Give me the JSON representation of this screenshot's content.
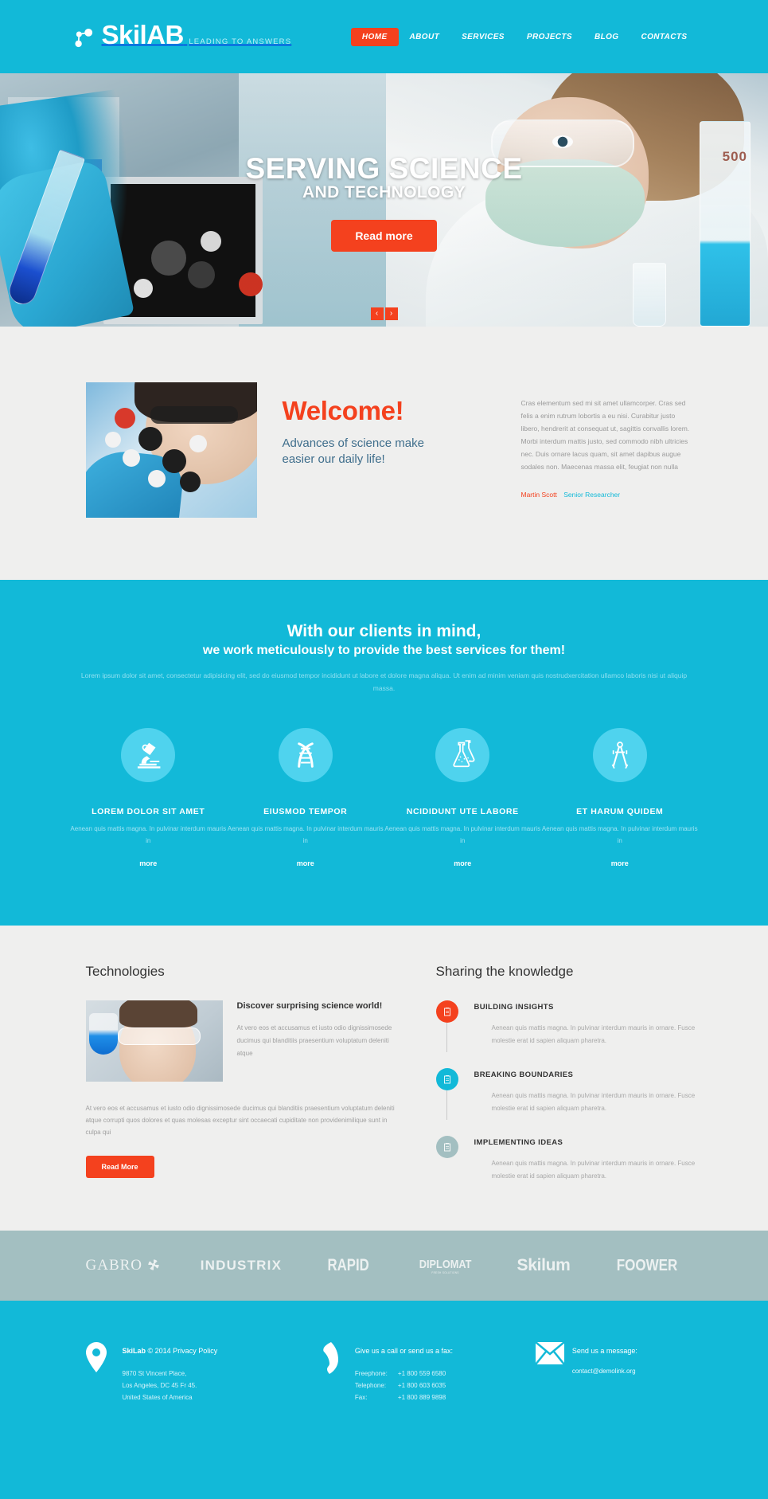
{
  "header": {
    "logo_name": "SkilAB",
    "logo_tagline": "LEADING TO ANSWERS",
    "nav": [
      {
        "label": "HOME",
        "active": true
      },
      {
        "label": "ABOUT",
        "active": false
      },
      {
        "label": "SERVICES",
        "active": false
      },
      {
        "label": "PROJECTS",
        "active": false
      },
      {
        "label": "BLOG",
        "active": false
      },
      {
        "label": "CONTACTS",
        "active": false
      }
    ]
  },
  "hero": {
    "title_line1": "SERVING SCIENCE",
    "title_line2": "AND TECHNOLOGY",
    "button": "Read more",
    "prev": "‹",
    "next": "›",
    "cylinder_label": "500"
  },
  "welcome": {
    "heading": "Welcome!",
    "subheading": "Advances of science make easier our daily life!",
    "paragraph": "Cras elementum sed mi sit amet ullamcorper. Cras sed felis a enim rutrum lobortis a eu nisi. Curabitur justo libero, hendrerit at consequat ut, sagittis convallis lorem. Morbi interdum mattis justo, sed commodo nibh ultricies nec. Duis ornare lacus quam, sit amet dapibus augue sodales non. Maecenas massa elit, feugiat non nulla",
    "credit_name": "Martin Scott",
    "credit_role": "Senior Researcher"
  },
  "clients": {
    "heading1": "With our clients in mind,",
    "heading2": "we work meticulously to provide the best services for them!",
    "paragraph": "Lorem ipsum dolor sit amet, consectetur adipisicing elit, sed do eiusmod tempor incididunt ut labore et dolore magna aliqua. Ut enim ad minim veniam quis nostrudxercitation ullamco laboris nisi ut aliquip massa.",
    "services": [
      {
        "icon": "microscope-icon",
        "title": "LOREM DOLOR SIT AMET",
        "text": "Aenean quis mattis magna. In pulvinar interdum mauris in",
        "more": "more"
      },
      {
        "icon": "dna-icon",
        "title": "EIUSMOD TEMPOR",
        "text": "Aenean quis mattis magna. In pulvinar interdum mauris in",
        "more": "more"
      },
      {
        "icon": "flasks-icon",
        "title": "NCIDIDUNT UTE LABORE",
        "text": "Aenean quis mattis magna. In pulvinar interdum mauris in",
        "more": "more"
      },
      {
        "icon": "compass-icon",
        "title": "ET HARUM QUIDEM",
        "text": "Aenean quis mattis magna. In pulvinar interdum mauris in",
        "more": "more"
      }
    ]
  },
  "technologies": {
    "heading": "Technologies",
    "card_title": "Discover surprising science world!",
    "card_text": "At vero eos et accusamus et iusto odio dignissimosede ducimus qui blanditiis praesentium voluptatum deleniti atque",
    "paragraph": "At vero eos et accusamus et iusto odio dignissimosede ducimus qui blanditiis praesentium voluptatum deleniti atque corrupti quos dolores et quas molesas exceptur sint occaecati cupiditate non providenimilique sunt in culpa qui",
    "button": "Read More"
  },
  "knowledge": {
    "heading": "Sharing the knowledge",
    "items": [
      {
        "title": "BUILDING INSIGHTS",
        "text": "Aenean quis mattis magna. In pulvinar interdum mauris in ornare. Fusce molestie erat id sapien aliquam pharetra.",
        "color": "#f4411e",
        "icon": "clipboard-icon"
      },
      {
        "title": "BREAKING BOUNDARIES",
        "text": "Aenean quis mattis magna. In pulvinar interdum mauris in ornare. Fusce molestie erat id sapien aliquam pharetra.",
        "color": "#12b9d8",
        "icon": "clipboard-icon"
      },
      {
        "title": "IMPLEMENTING IDEAS",
        "text": "Aenean quis mattis magna. In pulvinar interdum mauris in ornare. Fusce molestie erat id sapien aliquam pharetra.",
        "color": "#a3bfc1",
        "icon": "clipboard-icon"
      }
    ]
  },
  "partners": [
    {
      "name": "GABRO"
    },
    {
      "name": "INDUSTRIX"
    },
    {
      "name": "RAPID"
    },
    {
      "name": "DIPLOMAT",
      "sub": "FRESH SOLUTIONS"
    },
    {
      "name": "Skilum"
    },
    {
      "name": "FOOWER"
    }
  ],
  "footer": {
    "brand": "SkiLab",
    "copyright": "© 2014 Privacy Policy",
    "address_line1": "9870 St Vincent Place,",
    "address_line2": "Los Angeles, DC 45 Fr 45.",
    "address_line3": "United States of America",
    "phone_title": "Give us a call or send us a fax:",
    "freephone_label": "Freephone:",
    "freephone_value": "+1 800 559 6580",
    "telephone_label": "Telephone:",
    "telephone_value": "+1 800 603 6035",
    "fax_label": "Fax:",
    "fax_value": "+1 800 889 9898",
    "mail_title": "Send us a message:",
    "mail_value": "contact@demolink.org"
  },
  "colors": {
    "brand": "#12b9d8",
    "accent": "#f4411e",
    "light_blue": "#4fd3ee",
    "partners_bg": "#a3bfc1"
  }
}
